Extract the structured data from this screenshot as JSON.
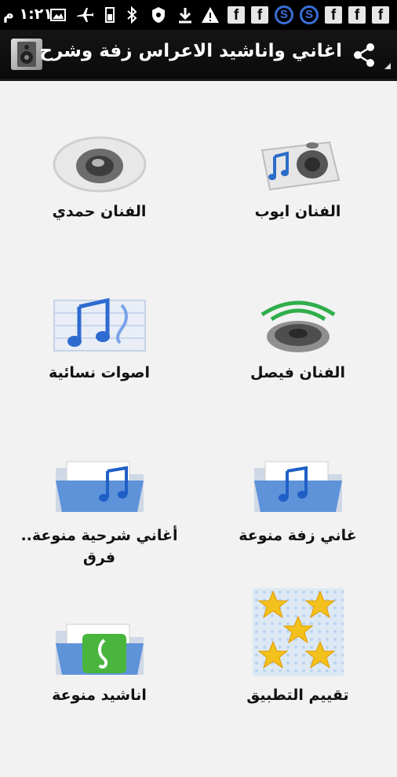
{
  "status_bar": {
    "time": "١:٢١ م",
    "icons": [
      "photo-icon",
      "airplane-icon",
      "sim-icon",
      "bluetooth-icon",
      "shield-icon",
      "download-icon",
      "warning-icon",
      "facebook-icon",
      "facebook-icon",
      "skype-icon",
      "skype-icon",
      "facebook-icon",
      "facebook-icon",
      "facebook-icon"
    ]
  },
  "action_bar": {
    "title": "اغاني واناشيد الاعراس زفة وشرح",
    "share_icon": "share-icon"
  },
  "grid": {
    "items": [
      {
        "label": "الفنان حمدي",
        "icon": "speaker-icon"
      },
      {
        "label": "الفنان ايوب",
        "icon": "music-speaker-icon"
      },
      {
        "label": "اصوات نسائية",
        "icon": "music-note-file-icon"
      },
      {
        "label": "الفنان فيصل",
        "icon": "sound-waves-speaker-icon"
      },
      {
        "label": "أغاني شرحية منوعة.. فرق",
        "icon": "music-folder-icon"
      },
      {
        "label": "غاني زفة منوعة",
        "icon": "music-folder-icon"
      },
      {
        "label": "اناشيد منوعة",
        "icon": "green-music-folder-icon"
      },
      {
        "label": "تقييم التطبيق",
        "icon": "stars-icon"
      }
    ]
  }
}
